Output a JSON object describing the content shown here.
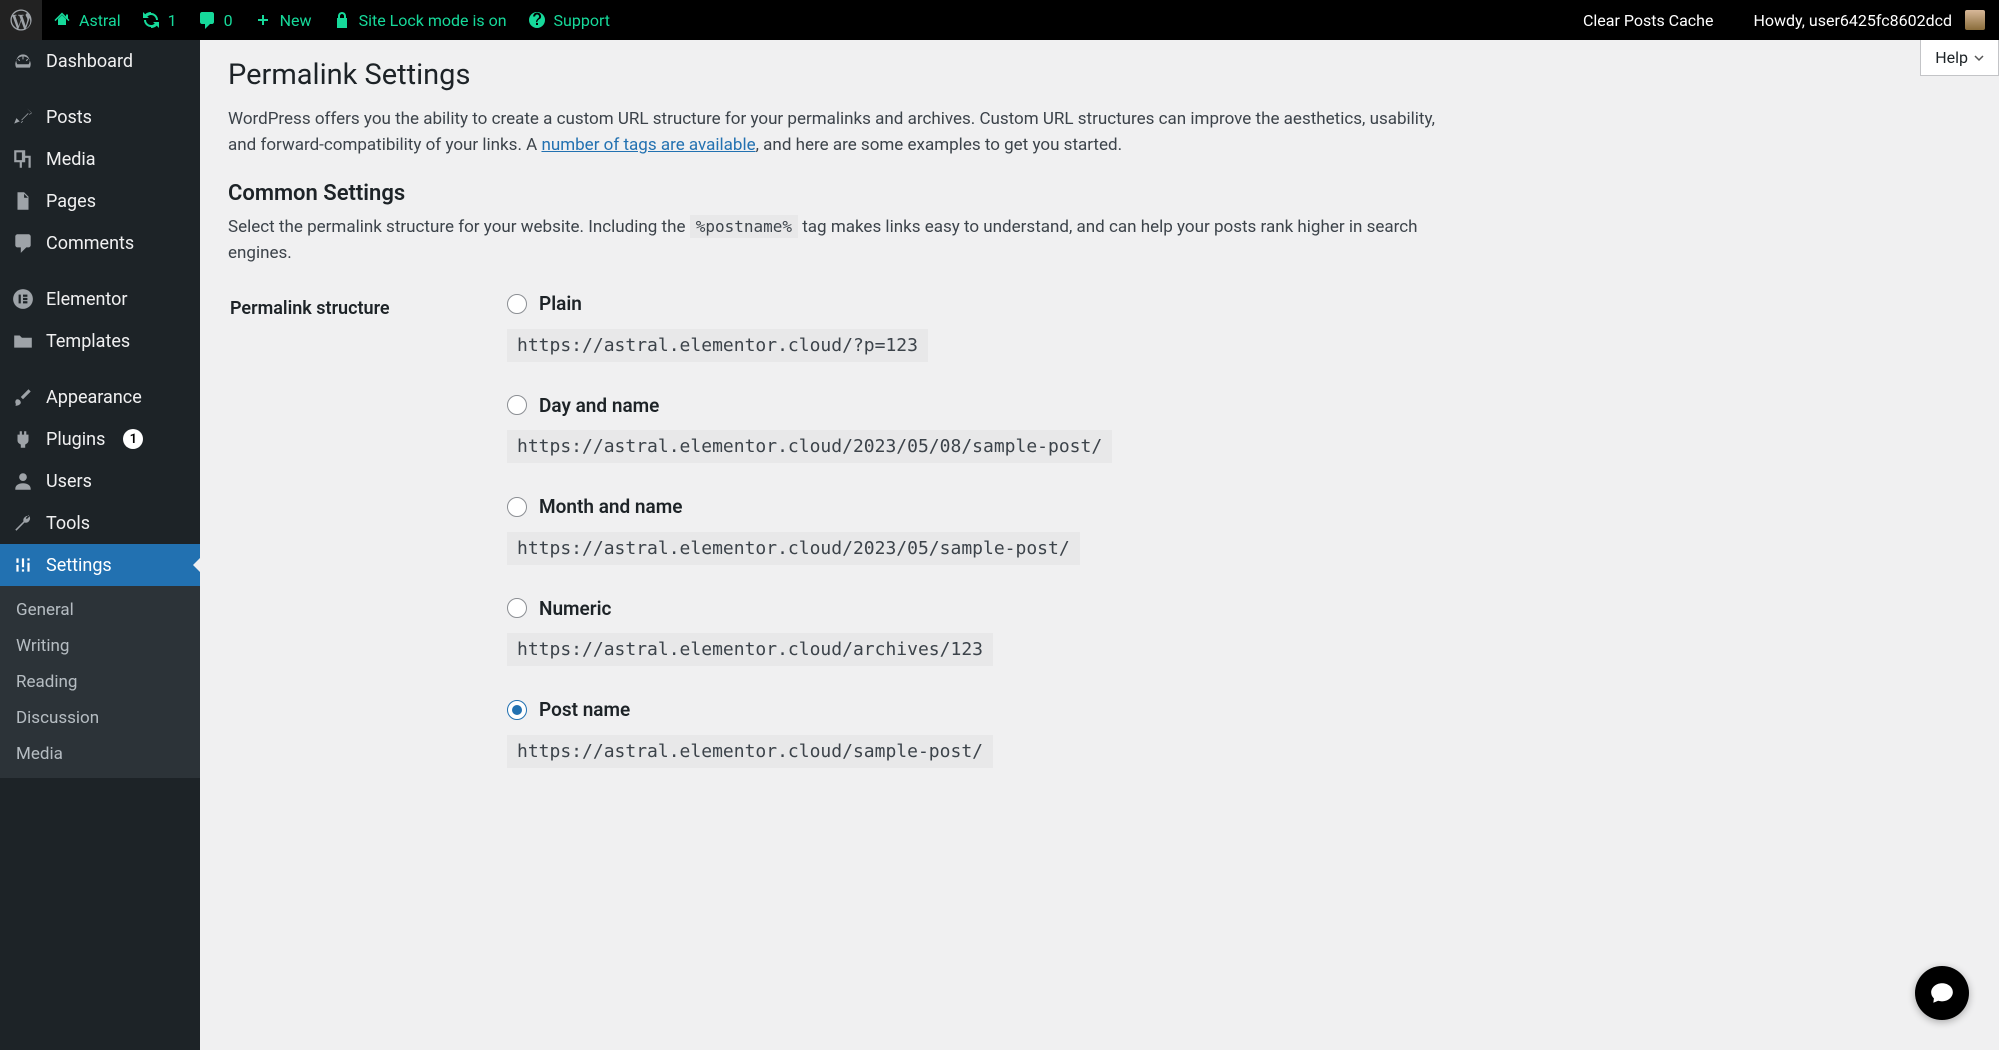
{
  "toolbar": {
    "site_name": "Astral",
    "updates_count": "1",
    "comments_count": "0",
    "new_label": "New",
    "sitelock_label": "Site Lock mode is on",
    "support_label": "Support",
    "clear_cache": "Clear Posts Cache",
    "greeting": "Howdy, user6425fc8602dcd"
  },
  "sidebar": {
    "items": [
      {
        "id": "dashboard",
        "label": "Dashboard"
      },
      {
        "id": "posts",
        "label": "Posts"
      },
      {
        "id": "media",
        "label": "Media"
      },
      {
        "id": "pages",
        "label": "Pages"
      },
      {
        "id": "comments",
        "label": "Comments"
      },
      {
        "id": "elementor",
        "label": "Elementor"
      },
      {
        "id": "templates",
        "label": "Templates"
      },
      {
        "id": "appearance",
        "label": "Appearance"
      },
      {
        "id": "plugins",
        "label": "Plugins",
        "badge": "1"
      },
      {
        "id": "users",
        "label": "Users"
      },
      {
        "id": "tools",
        "label": "Tools"
      },
      {
        "id": "settings",
        "label": "Settings"
      }
    ],
    "submenu": [
      {
        "label": "General"
      },
      {
        "label": "Writing"
      },
      {
        "label": "Reading"
      },
      {
        "label": "Discussion"
      },
      {
        "label": "Media"
      }
    ]
  },
  "page": {
    "help": "Help",
    "title": "Permalink Settings",
    "intro_1": "WordPress offers you the ability to create a custom URL structure for your permalinks and archives. Custom URL structures can improve the aesthetics, usability, and forward-compatibility of your links. A ",
    "intro_link": "number of tags are available",
    "intro_2": ", and here are some examples to get you started.",
    "common_h": "Common Settings",
    "common_desc_1": "Select the permalink structure for your website. Including the ",
    "common_code": "%postname%",
    "common_desc_2": " tag makes links easy to understand, and can help your posts rank higher in search engines.",
    "structure_label": "Permalink structure",
    "options": [
      {
        "label": "Plain",
        "example": "https://astral.elementor.cloud/?p=123",
        "checked": false
      },
      {
        "label": "Day and name",
        "example": "https://astral.elementor.cloud/2023/05/08/sample-post/",
        "checked": false
      },
      {
        "label": "Month and name",
        "example": "https://astral.elementor.cloud/2023/05/sample-post/",
        "checked": false
      },
      {
        "label": "Numeric",
        "example": "https://astral.elementor.cloud/archives/123",
        "checked": false
      },
      {
        "label": "Post name",
        "example": "https://astral.elementor.cloud/sample-post/",
        "checked": true
      }
    ]
  }
}
